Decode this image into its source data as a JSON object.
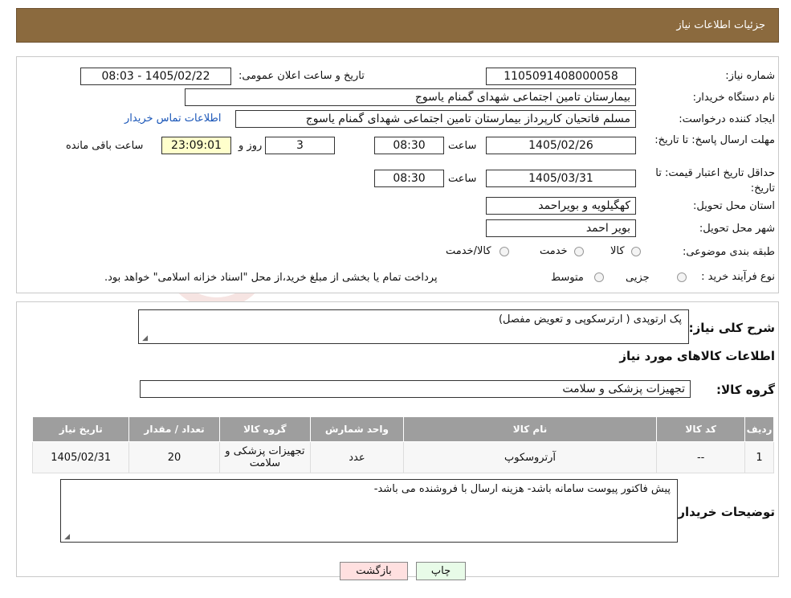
{
  "header": {
    "title": "جزئیات اطلاعات نیاز"
  },
  "form": {
    "need_number_label": "شماره نیاز:",
    "need_number": "1105091408000058",
    "announce_label": "تاریخ و ساعت اعلان عمومی:",
    "announce_value": "1405/02/22 - 08:03",
    "buyer_org_label": "نام دستگاه خریدار:",
    "buyer_org": "بیمارستان تامین اجتماعی شهدای گمنام یاسوج",
    "creator_label": "ایجاد کننده درخواست:",
    "creator": "مسلم فاتحیان کارپرداز بیمارستان تامین اجتماعی شهدای گمنام یاسوج",
    "contact_link": "اطلاعات تماس خریدار",
    "deadline_label": "مهلت ارسال پاسخ: تا تاریخ:",
    "deadline_date": "1405/02/26",
    "time_label": "ساعت",
    "deadline_time": "08:30",
    "days_count": "3",
    "days_and_label": "روز و",
    "remaining_time": "23:09:01",
    "remaining_label": "ساعت باقی مانده",
    "validity_label": "حداقل تاریخ اعتبار قیمت: تا تاریخ:",
    "validity_date": "1405/03/31",
    "validity_time": "08:30",
    "province_label": "استان محل تحویل:",
    "province": "کهگیلویه و بویراحمد",
    "city_label": "شهر محل تحویل:",
    "city": "بویر احمد",
    "category_label": "طبقه بندی موضوعی:",
    "category_options": [
      "کالا",
      "خدمت",
      "کالا/خدمت"
    ],
    "process_label": "نوع فرآیند خرید :",
    "process_options": [
      "جزیی",
      "متوسط"
    ],
    "process_note": "پرداخت تمام یا بخشی از مبلغ خرید،از محل \"اسناد خزانه اسلامی\" خواهد بود."
  },
  "summary": {
    "label": "شرح کلی نیاز:",
    "value": "پک ارتوپدی ( ارترسکوپی و تعویض مفصل)",
    "items_title": "اطلاعات کالاهای مورد نیاز",
    "group_label": "گروه کالا:",
    "group_value": "تجهیزات پزشکی و سلامت"
  },
  "table": {
    "headers": [
      "ردیف",
      "کد کالا",
      "نام کالا",
      "واحد شمارش",
      "گروه کالا",
      "تعداد / مقدار",
      "تاریخ نیاز"
    ],
    "rows": [
      [
        "1",
        "--",
        "آرتروسکوپ",
        "عدد",
        "تجهیزات پزشکی و سلامت",
        "20",
        "1405/02/31"
      ]
    ]
  },
  "notes": {
    "label": "توضیحات خریدار:",
    "value": "پیش فاکتور پیوست سامانه باشد- هزینه ارسال با فروشنده می باشد-"
  },
  "buttons": {
    "print": "چاپ",
    "back": "بازگشت"
  },
  "colors": {
    "header_bg": "#8b6a3e",
    "table_header_bg": "#9e9e9e",
    "back_btn_bg": "#ffe0e0",
    "print_btn_bg": "#e8fbe8"
  }
}
